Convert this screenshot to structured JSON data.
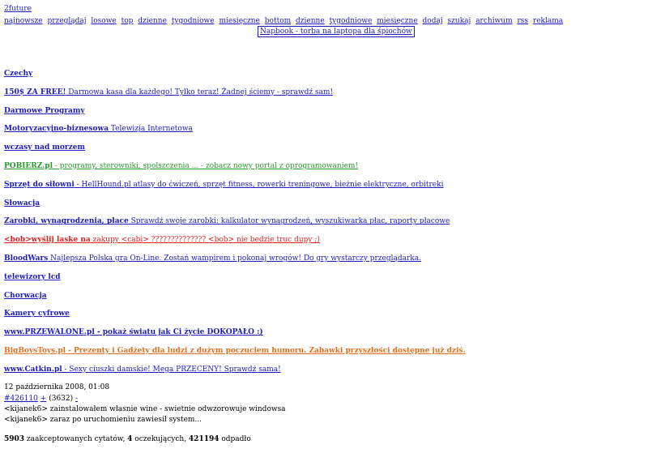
{
  "site": {
    "title": "2future"
  },
  "nav": [
    "najnowsze",
    "przeglądaj",
    "losowe",
    "top",
    "dzienne",
    "tygodniowe",
    "miesięczne",
    "bottom",
    "dzienne",
    "tygodniowe",
    "miesięczne",
    "dodaj",
    "szukaj",
    "archiwum",
    "rss",
    "reklama"
  ],
  "promo": {
    "label": "Napbook - torba na laptopa dla śpiochów"
  },
  "ads": [
    {
      "title": "Czechy",
      "desc": "",
      "color": "#1c1cbc"
    },
    {
      "title": "150$ ZA FREE!",
      "desc": " Darmowa kasa dla każdego! Tylko teraz! Żadnej ściemy - sprawdź sam!",
      "color": "#1c1cbc"
    },
    {
      "title": "Darmowe Programy",
      "desc": "",
      "color": "#1c1cbc"
    },
    {
      "title": "Motoryzacyjno-biznesowa",
      "desc": " Telewizja Internetowa",
      "color": "#1c1cbc"
    },
    {
      "title": "wczasy nad morzem",
      "desc": "",
      "color": "#1c1cbc"
    },
    {
      "title": "POBIERZ.pl",
      "desc": " - programy, sterowniki, spolszczenia ... - zobacz nowy portal z oprogramowaniem!",
      "color": "#2a9a2a"
    },
    {
      "title": "Sprzęt do siłowni",
      "desc": " - HellHound.pl atlasy do ćwiczeń, sprzęt fitness, rowerki treningowe, bieżnie elektryczne, orbitreki",
      "color": "#1c1cbc"
    },
    {
      "title": "Słowacja",
      "desc": "",
      "color": "#1c1cbc"
    },
    {
      "title": "Zarobki, wynagrodzenia, płace",
      "desc": " Sprawdź swoje zarobki: kalkulator wynagrodzeń, wyszukiwarka płac, raporty płacowe",
      "color": "#1c1cbc"
    },
    {
      "title": "<bob>wyślij laske na",
      "desc": " zakupy <cabi> ?????????????? <bob> nie bedzie truc dupy ;)",
      "color": "#e02020"
    },
    {
      "title": "BloodWars",
      "desc": " Najlepsza Polska gra On-Line. Zostań wampirem i pokonaj wrogów! Do gry wystarczy przeglądarka.",
      "color": "#1c1cbc"
    },
    {
      "title": "telewizory lcd",
      "desc": "",
      "color": "#1c1cbc"
    },
    {
      "title": "Chorwacja",
      "desc": "",
      "color": "#1c1cbc"
    },
    {
      "title": "Kamery cyfrowe",
      "desc": "",
      "color": "#1c1cbc"
    },
    {
      "title": "www.PRZEWALONE.pl - pokaż światu jak Ci życie DOKOPAŁO :)",
      "desc": "",
      "color": "#1c1cbc"
    },
    {
      "title": "BigBoysToys.pl - Prezenty i Gadżety dla ludzi z dużym poczuciem humoru. Zabawki przyszłości dostępne już dziś.",
      "desc": "",
      "color": "#e07020"
    },
    {
      "title": "www.Catkin.pl",
      "desc": " - Sexy ciuszki damskie! Mega PRZECENY! Sprawdź sama!",
      "color": "#1c1cbc"
    }
  ],
  "quote": {
    "date": "12 października 2008, 01:08",
    "id": "#426110",
    "plus": "+",
    "score": "(3632)",
    "minus": "-",
    "lines": [
      "<kijanek6> zainstalowałem własnie wine - swietnie odwzorowuje windowsa",
      "<kijanek6> zaraz po uruchomieniu zawiesił system..."
    ]
  },
  "stats": {
    "accepted": "5903",
    "accepted_label": " zaakceptowanych cytatów, ",
    "waiting": "4",
    "waiting_label": " oczekujących, ",
    "rejected": "421194",
    "rejected_label": " odpadło"
  }
}
